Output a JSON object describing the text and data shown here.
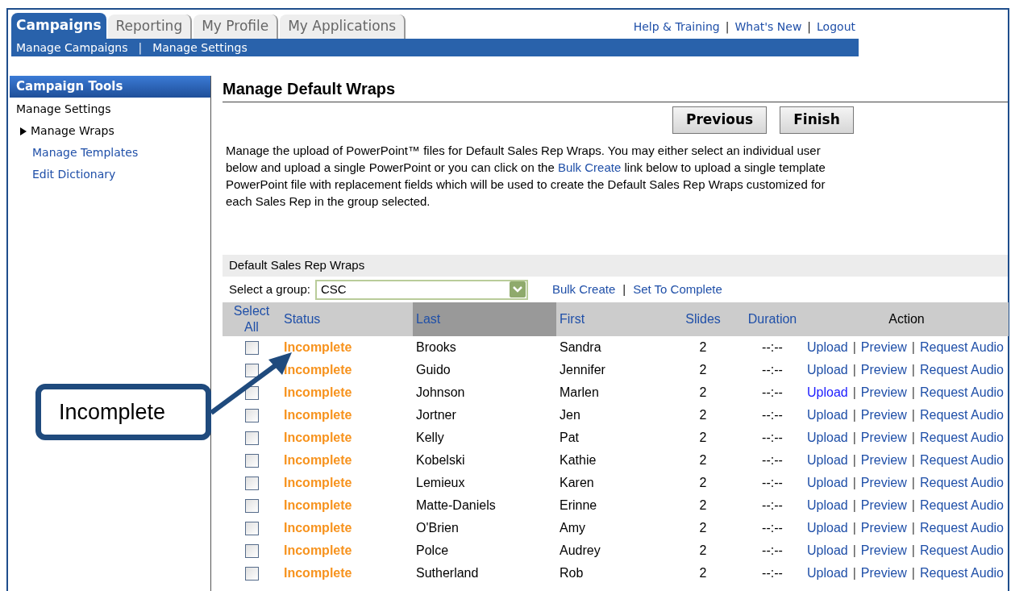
{
  "tabs": [
    {
      "label": "Campaigns",
      "selected": true
    },
    {
      "label": "Reporting",
      "selected": false
    },
    {
      "label": "My Profile",
      "selected": false
    },
    {
      "label": "My Applications",
      "selected": false
    }
  ],
  "subnav": [
    {
      "kind": "link",
      "text": "Manage Campaigns"
    },
    {
      "kind": "separator",
      "text": "|"
    },
    {
      "kind": "link",
      "text": "Manage Settings"
    }
  ],
  "top_links": [
    {
      "kind": "link",
      "text": "Help & Training"
    },
    {
      "kind": "separator",
      "text": "|"
    },
    {
      "kind": "link",
      "text": "What's New"
    },
    {
      "kind": "separator",
      "text": "|"
    },
    {
      "kind": "link",
      "text": "Logout"
    }
  ],
  "sidebar": {
    "title": "Campaign Tools",
    "items": [
      {
        "label": "Manage Settings",
        "kind": "heading",
        "children": [
          {
            "label": "Manage Wraps",
            "kind": "current"
          },
          {
            "label": "Manage Templates",
            "kind": "link"
          },
          {
            "label": "Edit Dictionary",
            "kind": "link"
          }
        ]
      }
    ]
  },
  "page_title": "Manage Default Wraps",
  "buttons": [
    "Previous",
    "Finish"
  ],
  "description": "Manage the upload of PowerPoint™ files for Default Sales Rep Wraps. You may either select an individual user below and upload a single PowerPoint or you can click on the ",
  "description_link": "Bulk Create",
  "description_end": " link below to upload a single template PowerPoint file with replacement fields which will be used to create the Default Sales Rep Wraps customized for each Sales Rep in the group selected.",
  "section_title": "Default Sales Rep Wraps",
  "group_label": "Select a group:",
  "group_value": "CSC",
  "group_links": [
    {
      "kind": "link",
      "text": "Bulk Create"
    },
    {
      "kind": "separator",
      "text": "|"
    },
    {
      "kind": "link",
      "text": "Set To Complete"
    }
  ],
  "table": {
    "columns": [
      {
        "label": "Select All",
        "sorted": false,
        "kind": "link"
      },
      {
        "label": "Status",
        "sorted": false,
        "kind": "link"
      },
      {
        "label": "Last",
        "sorted": true,
        "kind": "link"
      },
      {
        "label": "First",
        "sorted": false,
        "kind": "link"
      },
      {
        "label": "Slides",
        "sorted": false,
        "kind": "link"
      },
      {
        "label": "Duration",
        "sorted": false,
        "kind": "link"
      },
      {
        "label": "Action",
        "sorted": false,
        "kind": "text"
      }
    ],
    "rows": [
      {
        "checked": false,
        "status": "Incomplete",
        "last": "Brooks",
        "first": "Sandra",
        "slides": "2",
        "duration": "--:--",
        "actions": [
          {
            "kind": "link",
            "text": "Upload",
            "active": false
          },
          {
            "kind": "separator",
            "text": "|"
          },
          {
            "kind": "link",
            "text": "Preview",
            "active": false
          },
          {
            "kind": "separator",
            "text": "|"
          },
          {
            "kind": "link",
            "text": "Request Audio",
            "active": false
          }
        ]
      },
      {
        "checked": false,
        "status": "Incomplete",
        "last": "Guido",
        "first": "Jennifer",
        "slides": "2",
        "duration": "--:--",
        "actions": [
          {
            "kind": "link",
            "text": "Upload",
            "active": false
          },
          {
            "kind": "separator",
            "text": "|"
          },
          {
            "kind": "link",
            "text": "Preview",
            "active": false
          },
          {
            "kind": "separator",
            "text": "|"
          },
          {
            "kind": "link",
            "text": "Request Audio",
            "active": false
          }
        ]
      },
      {
        "checked": false,
        "status": "Incomplete",
        "last": "Johnson",
        "first": "Marlen",
        "slides": "2",
        "duration": "--:--",
        "actions": [
          {
            "kind": "link",
            "text": "Upload",
            "active": true
          },
          {
            "kind": "separator",
            "text": "|"
          },
          {
            "kind": "link",
            "text": "Preview",
            "active": false
          },
          {
            "kind": "separator",
            "text": "|"
          },
          {
            "kind": "link",
            "text": "Request Audio",
            "active": false
          }
        ]
      },
      {
        "checked": false,
        "status": "Incomplete",
        "last": "Jortner",
        "first": "Jen",
        "slides": "2",
        "duration": "--:--",
        "actions": [
          {
            "kind": "link",
            "text": "Upload",
            "active": false
          },
          {
            "kind": "separator",
            "text": "|"
          },
          {
            "kind": "link",
            "text": "Preview",
            "active": false
          },
          {
            "kind": "separator",
            "text": "|"
          },
          {
            "kind": "link",
            "text": "Request Audio",
            "active": false
          }
        ]
      },
      {
        "checked": false,
        "status": "Incomplete",
        "last": "Kelly",
        "first": "Pat",
        "slides": "2",
        "duration": "--:--",
        "actions": [
          {
            "kind": "link",
            "text": "Upload",
            "active": false
          },
          {
            "kind": "separator",
            "text": "|"
          },
          {
            "kind": "link",
            "text": "Preview",
            "active": false
          },
          {
            "kind": "separator",
            "text": "|"
          },
          {
            "kind": "link",
            "text": "Request Audio",
            "active": false
          }
        ]
      },
      {
        "checked": false,
        "status": "Incomplete",
        "last": "Kobelski",
        "first": "Kathie",
        "slides": "2",
        "duration": "--:--",
        "actions": [
          {
            "kind": "link",
            "text": "Upload",
            "active": false
          },
          {
            "kind": "separator",
            "text": "|"
          },
          {
            "kind": "link",
            "text": "Preview",
            "active": false
          },
          {
            "kind": "separator",
            "text": "|"
          },
          {
            "kind": "link",
            "text": "Request Audio",
            "active": false
          }
        ]
      },
      {
        "checked": false,
        "status": "Incomplete",
        "last": "Lemieux",
        "first": "Karen",
        "slides": "2",
        "duration": "--:--",
        "actions": [
          {
            "kind": "link",
            "text": "Upload",
            "active": false
          },
          {
            "kind": "separator",
            "text": "|"
          },
          {
            "kind": "link",
            "text": "Preview",
            "active": false
          },
          {
            "kind": "separator",
            "text": "|"
          },
          {
            "kind": "link",
            "text": "Request Audio",
            "active": false
          }
        ]
      },
      {
        "checked": false,
        "status": "Incomplete",
        "last": "Matte-Daniels",
        "first": "Erinne",
        "slides": "2",
        "duration": "--:--",
        "actions": [
          {
            "kind": "link",
            "text": "Upload",
            "active": false
          },
          {
            "kind": "separator",
            "text": "|"
          },
          {
            "kind": "link",
            "text": "Preview",
            "active": false
          },
          {
            "kind": "separator",
            "text": "|"
          },
          {
            "kind": "link",
            "text": "Request Audio",
            "active": false
          }
        ]
      },
      {
        "checked": false,
        "status": "Incomplete",
        "last": "O'Brien",
        "first": "Amy",
        "slides": "2",
        "duration": "--:--",
        "actions": [
          {
            "kind": "link",
            "text": "Upload",
            "active": false
          },
          {
            "kind": "separator",
            "text": "|"
          },
          {
            "kind": "link",
            "text": "Preview",
            "active": false
          },
          {
            "kind": "separator",
            "text": "|"
          },
          {
            "kind": "link",
            "text": "Request Audio",
            "active": false
          }
        ]
      },
      {
        "checked": false,
        "status": "Incomplete",
        "last": "Polce",
        "first": "Audrey",
        "slides": "2",
        "duration": "--:--",
        "actions": [
          {
            "kind": "link",
            "text": "Upload",
            "active": false
          },
          {
            "kind": "separator",
            "text": "|"
          },
          {
            "kind": "link",
            "text": "Preview",
            "active": false
          },
          {
            "kind": "separator",
            "text": "|"
          },
          {
            "kind": "link",
            "text": "Request Audio",
            "active": false
          }
        ]
      },
      {
        "checked": false,
        "status": "Incomplete",
        "last": "Sutherland",
        "first": "Rob",
        "slides": "2",
        "duration": "--:--",
        "actions": [
          {
            "kind": "link",
            "text": "Upload",
            "active": false
          },
          {
            "kind": "separator",
            "text": "|"
          },
          {
            "kind": "link",
            "text": "Preview",
            "active": false
          },
          {
            "kind": "separator",
            "text": "|"
          },
          {
            "kind": "link",
            "text": "Request Audio",
            "active": false
          }
        ]
      }
    ]
  },
  "callout": {
    "text": "Incomplete"
  }
}
